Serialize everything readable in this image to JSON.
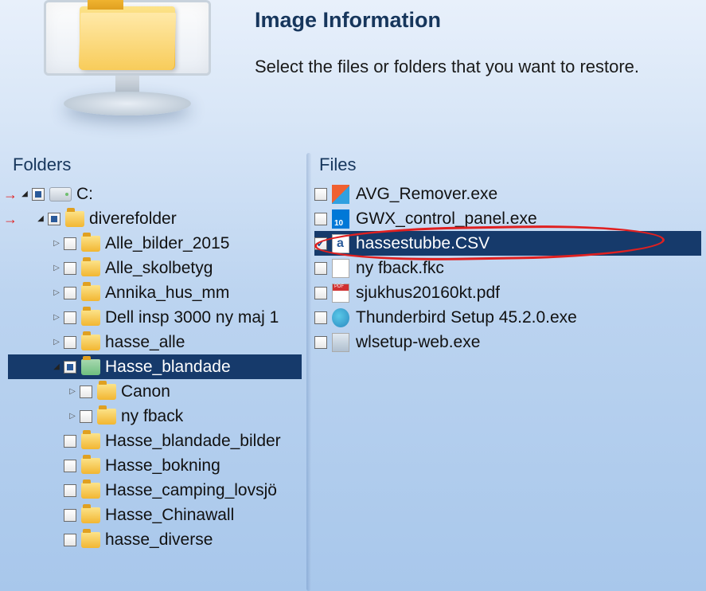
{
  "header": {
    "title": "Image Information",
    "subtitle": "Select the files or folders that you want to restore."
  },
  "columns": {
    "folders_label": "Folders",
    "files_label": "Files"
  },
  "tree": [
    {
      "indent": 0,
      "expander": "expanded",
      "check": "indeterminate",
      "icon": "drive",
      "label": "C:",
      "arrow": true
    },
    {
      "indent": 1,
      "expander": "expanded",
      "check": "indeterminate",
      "icon": "folder",
      "label": "diverefolder",
      "arrow": true
    },
    {
      "indent": 2,
      "expander": "collapsed",
      "check": "none",
      "icon": "folder",
      "label": "Alle_bilder_2015"
    },
    {
      "indent": 2,
      "expander": "collapsed",
      "check": "none",
      "icon": "folder",
      "label": "Alle_skolbetyg"
    },
    {
      "indent": 2,
      "expander": "collapsed",
      "check": "none",
      "icon": "folder",
      "label": "Annika_hus_mm"
    },
    {
      "indent": 2,
      "expander": "collapsed",
      "check": "none",
      "icon": "folder",
      "label": "Dell insp 3000 ny maj 1"
    },
    {
      "indent": 2,
      "expander": "collapsed",
      "check": "none",
      "icon": "folder",
      "label": "hasse_alle"
    },
    {
      "indent": 2,
      "expander": "expanded",
      "check": "indeterminate",
      "icon": "folder-open",
      "label": "Hasse_blandade",
      "selected": true
    },
    {
      "indent": 3,
      "expander": "collapsed",
      "check": "none",
      "icon": "folder",
      "label": "Canon"
    },
    {
      "indent": 3,
      "expander": "collapsed",
      "check": "none",
      "icon": "folder",
      "label": "ny fback"
    },
    {
      "indent": 2,
      "expander": "none",
      "check": "none",
      "icon": "folder",
      "label": "Hasse_blandade_bilder"
    },
    {
      "indent": 2,
      "expander": "none",
      "check": "none",
      "icon": "folder",
      "label": "Hasse_bokning"
    },
    {
      "indent": 2,
      "expander": "none",
      "check": "none",
      "icon": "folder",
      "label": "Hasse_camping_lovsjö"
    },
    {
      "indent": 2,
      "expander": "none",
      "check": "none",
      "icon": "folder",
      "label": "Hasse_Chinawall"
    },
    {
      "indent": 2,
      "expander": "none",
      "check": "none",
      "icon": "folder",
      "label": "hasse_diverse"
    }
  ],
  "files": [
    {
      "check": "none",
      "icon": "avg",
      "label": "AVG_Remover.exe"
    },
    {
      "check": "none",
      "icon": "win10",
      "label": "GWX_control_panel.exe"
    },
    {
      "check": "checked",
      "icon": "csv",
      "label": "hassestubbe.CSV",
      "selected": true,
      "circled": true
    },
    {
      "check": "none",
      "icon": "generic",
      "label": "ny fback.fkc"
    },
    {
      "check": "none",
      "icon": "pdf",
      "label": "sjukhus20160kt.pdf"
    },
    {
      "check": "none",
      "icon": "tbird",
      "label": "Thunderbird Setup 45.2.0.exe"
    },
    {
      "check": "none",
      "icon": "wlsetup",
      "label": "wlsetup-web.exe"
    }
  ]
}
